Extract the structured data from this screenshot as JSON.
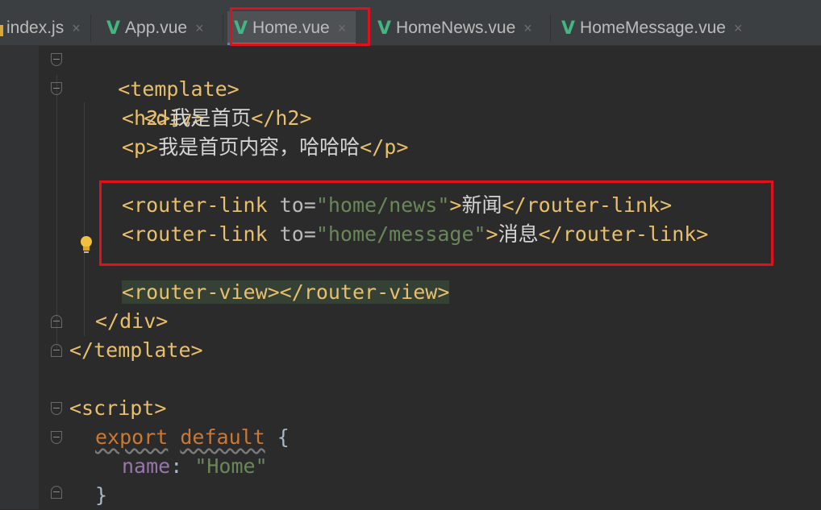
{
  "tabs": [
    {
      "label": "index.js",
      "icon": "js-file-icon",
      "active": false
    },
    {
      "label": "App.vue",
      "icon": "vue-file-icon",
      "active": false
    },
    {
      "label": "Home.vue",
      "icon": "vue-file-icon",
      "active": true
    },
    {
      "label": "HomeNews.vue",
      "icon": "vue-file-icon",
      "active": false
    },
    {
      "label": "HomeMessage.vue",
      "icon": "vue-file-icon",
      "active": false
    }
  ],
  "tab_close_glyph": "×",
  "vue_glyph": "V",
  "code": {
    "l1": {
      "open": "<template>"
    },
    "l2": {
      "open": "<div>"
    },
    "l3": {
      "open": "<h2>",
      "text": "我是首页",
      "close": "</h2>"
    },
    "l4": {
      "open": "<p>",
      "text": "我是首页内容，哈哈哈",
      "close": "</p>"
    },
    "l6": {
      "tag_open": "<router-link ",
      "attr": "to=",
      "value": "\"home/news\"",
      "gt": ">",
      "text": "新闻",
      "close": "</router-link>"
    },
    "l7": {
      "tag_open": "<router-link ",
      "attr": "to=",
      "value": "\"home/message\"",
      "gt": ">",
      "text": "消息",
      "close": "</router-link>"
    },
    "l9": {
      "code": "<router-view></router-view>"
    },
    "l10": {
      "close": "</div>"
    },
    "l11": {
      "close": "</template>"
    },
    "l13": {
      "open": "<script>"
    },
    "l14": {
      "kw1": "export",
      "kw2": "default",
      "brace": " {"
    },
    "l15": {
      "prop": "name",
      "colon": ": ",
      "value": "\"Home\""
    },
    "l16": {
      "brace": "}"
    }
  },
  "colors": {
    "highlight_box": "#e0101c",
    "vue_icon": "#41b883",
    "tag": "#e8bf6a",
    "string": "#6a8759",
    "keyword": "#cc7832",
    "property": "#9876aa"
  }
}
